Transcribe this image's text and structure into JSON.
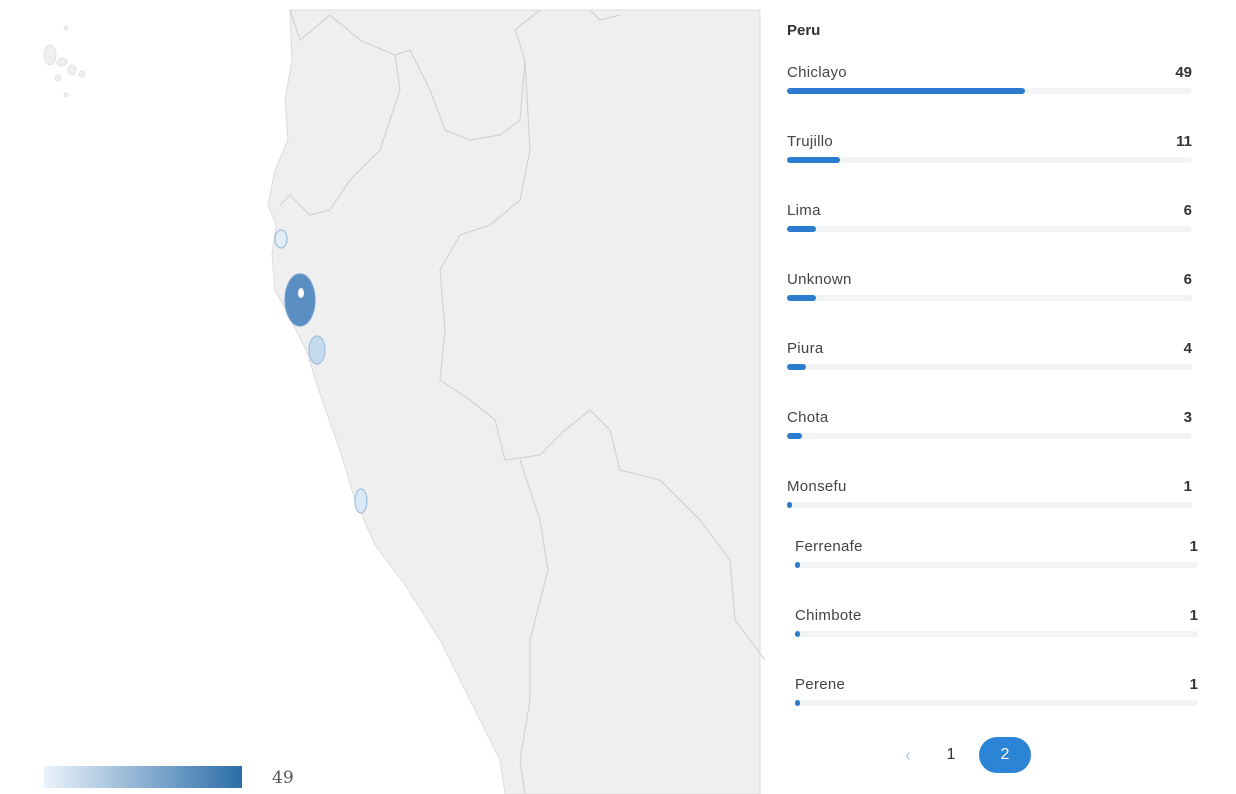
{
  "panel": {
    "title": "Peru",
    "rows": [
      {
        "label": "Chiclayo",
        "value": "49",
        "fraction": 1.0
      },
      {
        "label": "Trujillo",
        "value": "11",
        "fraction": 0.2245
      },
      {
        "label": "Lima",
        "value": "6",
        "fraction": 0.1224
      },
      {
        "label": "Unknown",
        "value": "6",
        "fraction": 0.1224
      },
      {
        "label": "Piura",
        "value": "4",
        "fraction": 0.0816
      },
      {
        "label": "Chota",
        "value": "3",
        "fraction": 0.0612
      },
      {
        "label": "Monsefu",
        "value": "1",
        "fraction": 0.0204
      },
      {
        "label": "Ferrenafe",
        "value": "1",
        "fraction": 0.0204
      },
      {
        "label": "Chimbote",
        "value": "1",
        "fraction": 0.0204
      },
      {
        "label": "Perene",
        "value": "1",
        "fraction": 0.0204
      }
    ]
  },
  "pagination": {
    "prev_icon": "chevron-left-icon",
    "pages": [
      "1",
      "2"
    ],
    "active_page": "2"
  },
  "legend": {
    "min": "1",
    "max": "49",
    "color_low": "#eaf3fb",
    "color_high": "#2b6ea8"
  },
  "colors": {
    "accent": "#2b7ccf",
    "land": "#efefef",
    "border": "#d4d4d4",
    "bubble": "#4f8cc6"
  }
}
